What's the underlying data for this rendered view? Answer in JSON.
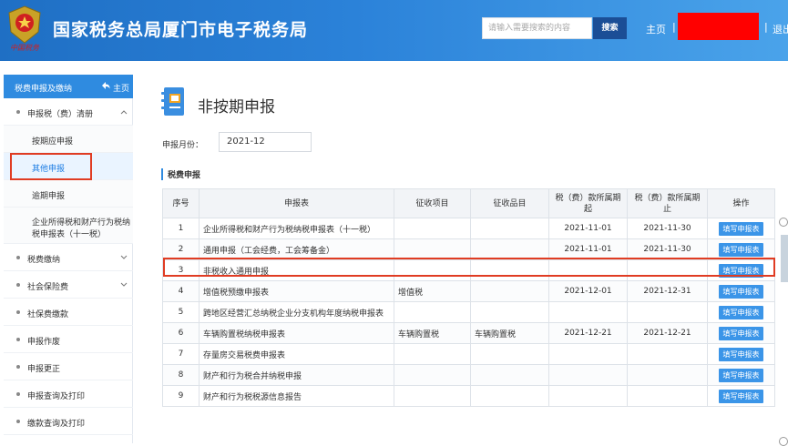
{
  "header": {
    "site_title": "国家税务总局厦门市电子税务局",
    "logo_caption": "中国税务",
    "search_placeholder": "请输入需要搜索的内容",
    "search_button": "搜索",
    "home_link": "主页",
    "separator": "|",
    "logout_link": "退出"
  },
  "sidebar": {
    "title": "税费申报及缴纳",
    "home_label": "主页",
    "items": [
      {
        "label": "申报税（费）清册",
        "expandable": true
      },
      {
        "label": "按期应申报",
        "sub": true
      },
      {
        "label": "其他申报",
        "sub": true,
        "active": true
      },
      {
        "label": "逾期申报",
        "sub": true
      },
      {
        "label": "企业所得税和财产行为税纳税申报表（十一税）",
        "line1": "企业所得税和财产行为税纳",
        "line2": "税申报表（十一税）",
        "sub": true
      },
      {
        "label": "税费缴纳",
        "expandable": true
      },
      {
        "label": "社会保险费",
        "expandable": true
      },
      {
        "label": "社保费缴款"
      },
      {
        "label": "申报作废"
      },
      {
        "label": "申报更正"
      },
      {
        "label": "申报查询及打印"
      },
      {
        "label": "缴款查询及打印"
      }
    ]
  },
  "main": {
    "page_title": "非按期申报",
    "month_label": "申报月份：",
    "month_value": "2021-12",
    "section_title": "税费申报",
    "columns": [
      "序号",
      "申报表",
      "征收项目",
      "征收品目",
      "税（费）款所属期起",
      "税（费）款所属期止",
      "操作"
    ],
    "action_label": "填写申报表",
    "rows": [
      {
        "no": "1",
        "form": "企业所得税和财产行为税纳税申报表（十一税）",
        "item": "",
        "sub_item": "",
        "start": "2021-11-01",
        "end": "2021-11-30"
      },
      {
        "no": "2",
        "form": "通用申报（工会经费，工会筹备金）",
        "item": "",
        "sub_item": "",
        "start": "2021-11-01",
        "end": "2021-11-30"
      },
      {
        "no": "3",
        "form": "非税收入通用申报",
        "item": "",
        "sub_item": "",
        "start": "",
        "end": ""
      },
      {
        "no": "4",
        "form": "增值税预缴申报表",
        "item": "增值税",
        "sub_item": "",
        "start": "2021-12-01",
        "end": "2021-12-31"
      },
      {
        "no": "5",
        "form": "跨地区经营汇总纳税企业分支机构年度纳税申报表",
        "item": "",
        "sub_item": "",
        "start": "",
        "end": ""
      },
      {
        "no": "6",
        "form": "车辆购置税纳税申报表",
        "item": "车辆购置税",
        "sub_item": "车辆购置税",
        "start": "2021-12-21",
        "end": "2021-12-21"
      },
      {
        "no": "7",
        "form": "存量房交易税费申报表",
        "item": "",
        "sub_item": "",
        "start": "",
        "end": ""
      },
      {
        "no": "8",
        "form": "财产和行为税合并纳税申报",
        "item": "",
        "sub_item": "",
        "start": "",
        "end": ""
      },
      {
        "no": "9",
        "form": "财产和行为税税源信息报告",
        "item": "",
        "sub_item": "",
        "start": "",
        "end": ""
      }
    ]
  },
  "colors": {
    "header_blue": "#2b82d9",
    "sidebar_head": "#2f8be0",
    "button_blue": "#3b95e8",
    "highlight_red": "#e03c23",
    "redacted_user": "#ff0000"
  }
}
